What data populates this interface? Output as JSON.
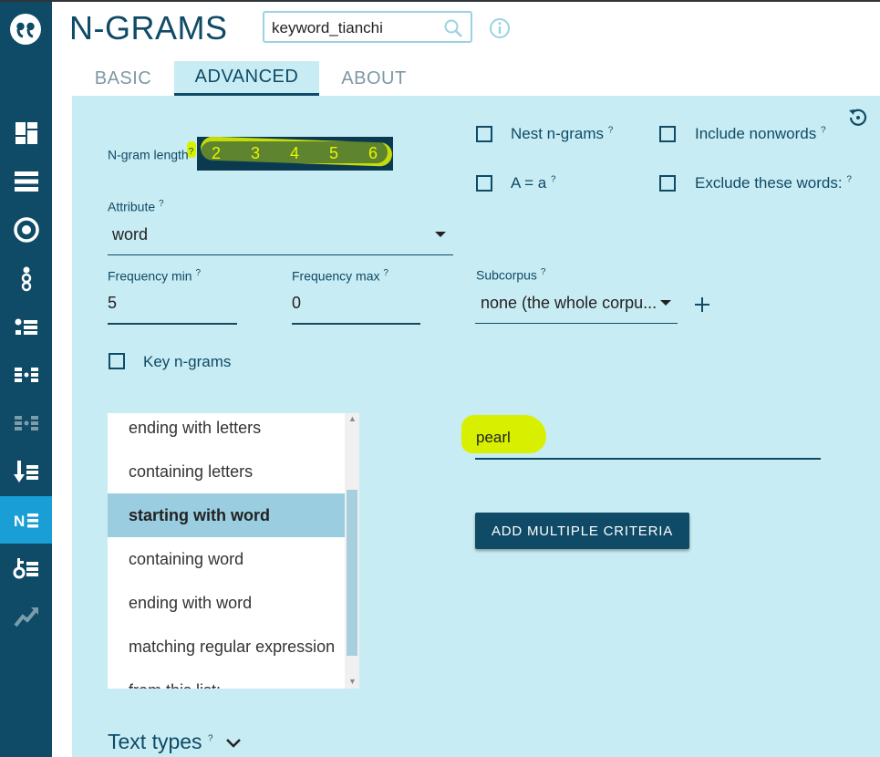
{
  "app": {
    "title": "N-GRAMS"
  },
  "search": {
    "value": "keyword_tianchi"
  },
  "tabs": [
    {
      "label": "BASIC",
      "active": false
    },
    {
      "label": "ADVANCED",
      "active": true
    },
    {
      "label": "ABOUT",
      "active": false
    }
  ],
  "sidebar": {
    "active_index": 8,
    "items": [
      {
        "icon": "dashboard-icon"
      },
      {
        "icon": "list-icon"
      },
      {
        "icon": "target-icon"
      },
      {
        "icon": "word-sketch-icon"
      },
      {
        "icon": "bullet-list-icon"
      },
      {
        "icon": "parallel-list-icon"
      },
      {
        "icon": "parallel-list-disabled-icon"
      },
      {
        "icon": "sort-down-list-icon"
      },
      {
        "icon": "ngram-list-icon"
      },
      {
        "icon": "keywords-list-icon"
      },
      {
        "icon": "trends-icon"
      }
    ]
  },
  "ngram": {
    "label": "N-gram length",
    "help": "?",
    "values": [
      "2",
      "3",
      "4",
      "5",
      "6"
    ]
  },
  "options": {
    "nest": {
      "label": "Nest n-grams",
      "help": "?",
      "checked": false
    },
    "include_nonwords": {
      "label": "Include nonwords",
      "help": "?",
      "checked": false
    },
    "case": {
      "label": "A = a",
      "help": "?",
      "checked": false
    },
    "exclude": {
      "label": "Exclude these words:",
      "help": "?",
      "checked": false
    },
    "key_ngrams": {
      "label": "Key n-grams",
      "checked": false
    }
  },
  "attribute": {
    "label": "Attribute",
    "help": "?",
    "value": "word"
  },
  "freq_min": {
    "label": "Frequency min",
    "help": "?",
    "value": "5"
  },
  "freq_max": {
    "label": "Frequency max",
    "help": "?",
    "value": "0"
  },
  "subcorpus": {
    "label": "Subcorpus",
    "help": "?",
    "value": "none (the whole corpu..."
  },
  "criteria": {
    "items": [
      "ending with letters",
      "containing letters",
      "starting with word",
      "containing word",
      "ending with word",
      "matching regular expression",
      "from this list:"
    ],
    "selected": "starting with word",
    "value": "pearl",
    "button_label": "ADD MULTIPLE CRITERIA"
  },
  "text_types": {
    "label": "Text types",
    "help": "?"
  },
  "colors": {
    "sidebar": "#0f4a66",
    "sidebar_active": "#1a9ed6",
    "panel": "#c8ecf3",
    "primary": "#0f4a66",
    "highlight": "#d8f000"
  }
}
